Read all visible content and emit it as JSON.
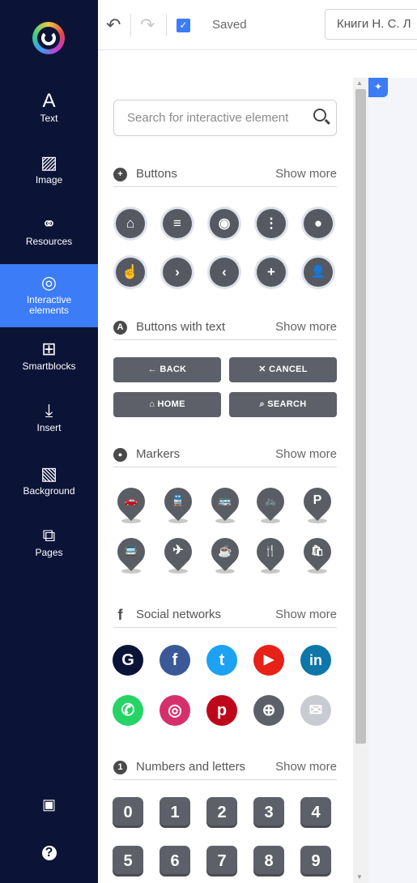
{
  "sidebar": {
    "items": [
      {
        "label": "Text",
        "icon": "A"
      },
      {
        "label": "Image",
        "icon": "▨"
      },
      {
        "label": "Resources",
        "icon": "⚭"
      },
      {
        "label": "Interactive elements",
        "icon": "◎"
      },
      {
        "label": "Smartblocks",
        "icon": "⊞"
      },
      {
        "label": "Insert",
        "icon": "⤓"
      },
      {
        "label": "Background",
        "icon": "▧"
      },
      {
        "label": "Pages",
        "icon": "⧉"
      }
    ],
    "bottom": [
      {
        "icon": "▣"
      },
      {
        "icon": "?"
      }
    ],
    "active_color": "#3c7cf6",
    "bg_color": "#0b1437"
  },
  "toolbar": {
    "undo_icon": "↶",
    "redo_icon": "↷",
    "check_icon": "✓",
    "saved_label": "Saved",
    "title": "Книги Н. С. Л"
  },
  "search": {
    "placeholder": "Search for interactive element"
  },
  "sections": {
    "buttons": {
      "title": "Buttons",
      "more": "Show more",
      "icon": "+"
    },
    "buttons_text": {
      "title": "Buttons with text",
      "more": "Show more",
      "icon": "A"
    },
    "markers": {
      "title": "Markers",
      "more": "Show more",
      "icon": "●"
    },
    "social": {
      "title": "Social networks",
      "more": "Show more",
      "icon": "f"
    },
    "numbers": {
      "title": "Numbers and letters",
      "more": "Show more",
      "icon": "1"
    }
  },
  "circle_buttons": [
    "⌂",
    "≡",
    "◉",
    "⋮",
    "●",
    "☝",
    "›",
    "‹",
    "+",
    "👤"
  ],
  "text_buttons": [
    "← BACK",
    "✕ CANCEL",
    "⌂ HOME",
    "⌕ SEARCH"
  ],
  "markers": [
    "🚗",
    "🚆",
    "🚌",
    "🚲",
    "P",
    "🚍",
    "✈",
    "☕",
    "🍴",
    "🛍"
  ],
  "social_networks": [
    {
      "name": "genially",
      "glyph": "G",
      "color": "#0b1437"
    },
    {
      "name": "facebook",
      "glyph": "f",
      "color": "#3b5998"
    },
    {
      "name": "twitter",
      "glyph": "t",
      "color": "#1da1f2"
    },
    {
      "name": "youtube",
      "glyph": "▶",
      "color": "#e62117"
    },
    {
      "name": "linkedin",
      "glyph": "in",
      "color": "#0e76a8"
    },
    {
      "name": "whatsapp",
      "glyph": "✆",
      "color": "#25d366"
    },
    {
      "name": "instagram",
      "glyph": "◎",
      "color": "#d6306b"
    },
    {
      "name": "pinterest",
      "glyph": "p",
      "color": "#bd081c"
    },
    {
      "name": "website",
      "glyph": "⊕",
      "color": "#5d6069"
    },
    {
      "name": "email",
      "glyph": "✉",
      "color": "#c9cbd2"
    }
  ],
  "numbers": [
    "0",
    "1",
    "2",
    "3",
    "4",
    "5",
    "6",
    "7",
    "8",
    "9"
  ]
}
